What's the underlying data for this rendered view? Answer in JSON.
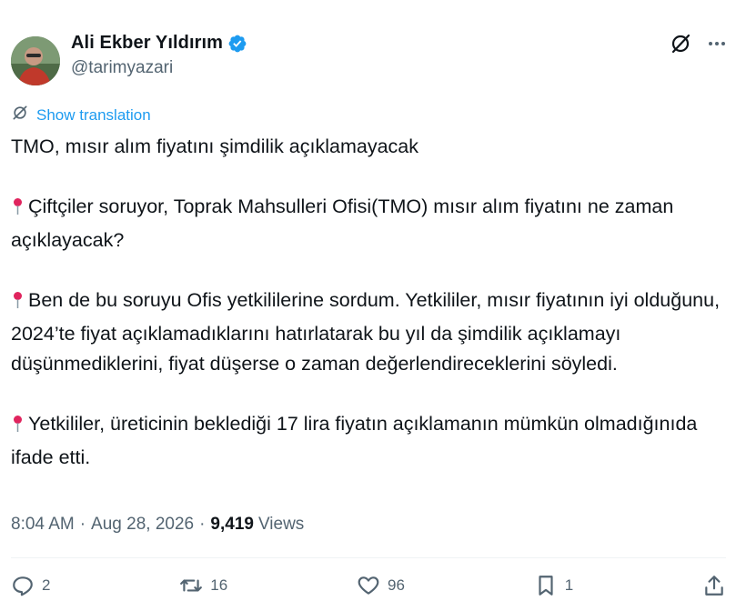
{
  "author": {
    "display_name": "Ali Ekber Yıldırım",
    "handle": "@tarimyazari",
    "verified": true
  },
  "header_icons": [
    "grok-icon",
    "more-icon"
  ],
  "translate_label": "Show translation",
  "tweet": {
    "title": "TMO,  mısır alım fiyatını şimdilik açıklamayacak",
    "paragraphs": [
      "Çiftçiler soruyor, Toprak Mahsulleri Ofisi(TMO) mısır alım fiyatını ne zaman açıklayacak?",
      "Ben de bu soruyu Ofis yetkililerine sordum.  Yetkililer, mısır fiyatının iyi olduğunu, 2024’te fiyat açıklamadıklarını hatırlatarak bu yıl da şimdilik açıklamayı düşünmediklerini, fiyat düşerse o zaman değerlendireceklerini söyledi.",
      "Yetkililer, üreticinin beklediği 17 lira fiyatın açıklamanın mümkün olmadığınıda ifade etti."
    ]
  },
  "meta": {
    "time": "8:04 AM",
    "separator": "·",
    "date": "Aug 28, 2026",
    "views_count": "9,419",
    "views_label": "Views"
  },
  "stats": {
    "replies": "2",
    "reposts": "16",
    "likes": "96",
    "bookmarks": "1"
  },
  "colors": {
    "accent": "#1d9bf0",
    "text": "#0f1419",
    "secondary": "#536471",
    "pin": "#e0245e"
  }
}
